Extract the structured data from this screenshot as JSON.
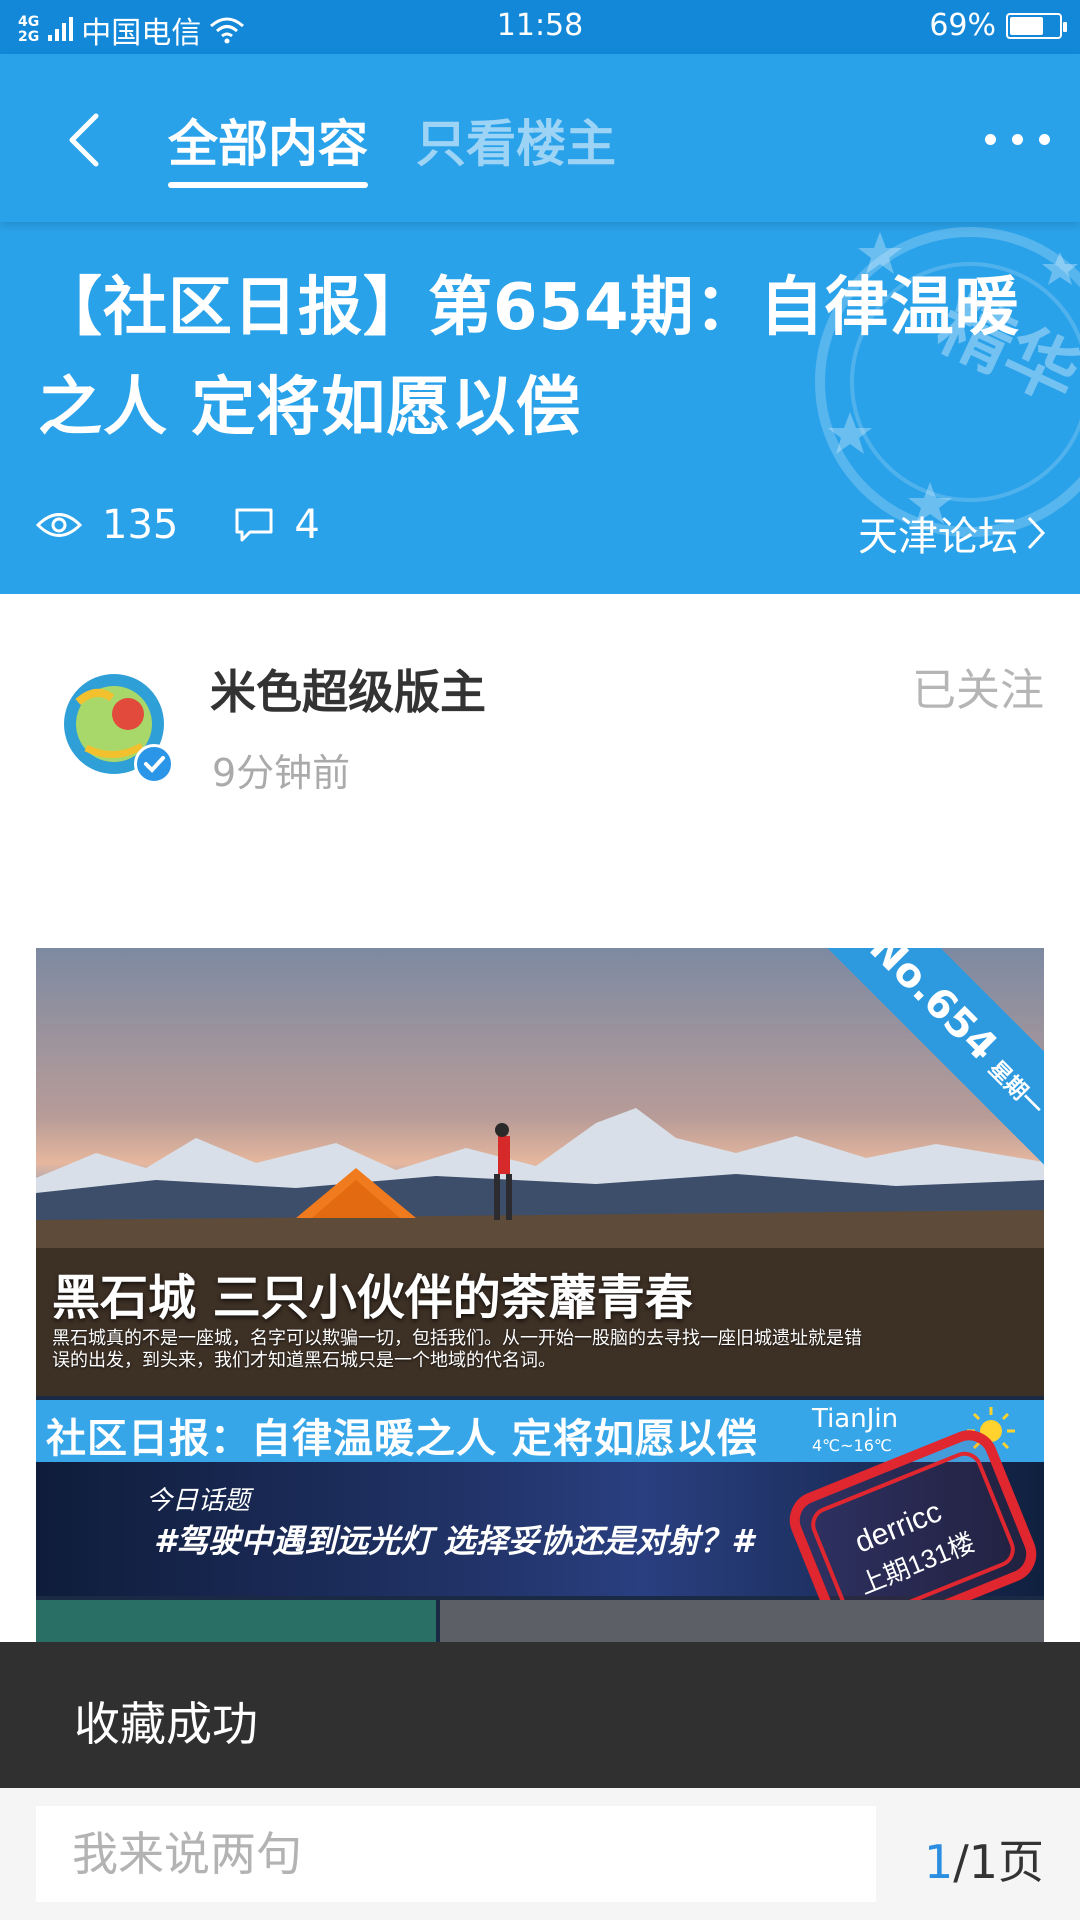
{
  "status_bar": {
    "network_top": "4G",
    "network_bottom": "2G",
    "carrier": "中国电信",
    "time": "11:58",
    "battery_text": "69%",
    "battery_level": 0.69
  },
  "nav": {
    "tab_all": "全部内容",
    "tab_op": "只看楼主"
  },
  "post": {
    "title": "【社区日报】第654期：自律温暖之人 定将如愿以偿",
    "views": "135",
    "comments": "4",
    "forum": "天津论坛",
    "badge_text": "精华"
  },
  "author": {
    "name": "米色超级版主",
    "time": "9分钟前",
    "follow_status": "已关注"
  },
  "poster": {
    "ribbon_no": "No.654",
    "ribbon_day": "星期一",
    "headline": "黑石城 三只小伙伴的荼蘼青春",
    "summary": "黑石城真的不是一座城，名字可以欺骗一切，包括我们。从一开始一股脑的去寻找一座旧城遗址就是错误的出发，到头来，我们才知道黑石城只是一个地域的代名词。",
    "strip_text": "社区日报：自律温暖之人 定将如愿以偿",
    "city": "TianJin",
    "temp": "4℃~16℃",
    "topic_label": "今日话题",
    "topic_question": "#驾驶中遇到远光灯 选择妥协还是对射？#",
    "seal_user": "derricc",
    "seal_floor": "上期131楼"
  },
  "toast": {
    "message": "收藏成功"
  },
  "bottom": {
    "reply_placeholder": "我来说两句",
    "page_current": "1",
    "page_total": "/1页"
  },
  "colors": {
    "brand_blue": "#2aa2ea",
    "status_blue": "#1388d8",
    "toast_bg": "#303030"
  }
}
